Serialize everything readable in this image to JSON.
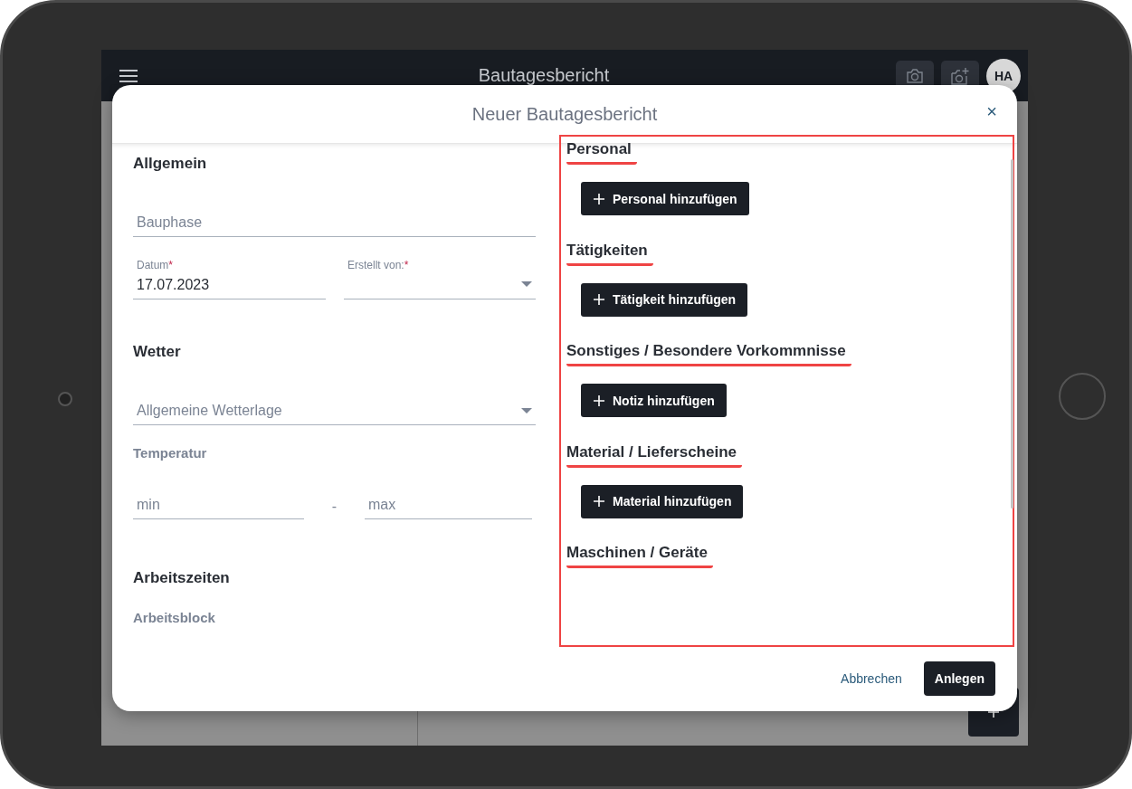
{
  "app_bar": {
    "title": "Bautagesbericht",
    "avatar": "HA"
  },
  "dialog": {
    "title": "Neuer Bautagesbericht",
    "close": "×",
    "general": {
      "heading": "Allgemein",
      "phase_field": {
        "placeholder": "Bauphase"
      },
      "date_field": {
        "label": "Datum",
        "required_mark": "*",
        "value": "17.07.2023"
      },
      "author_field": {
        "label": "Erstellt von:",
        "required_mark": "*"
      }
    },
    "weather": {
      "heading": "Wetter",
      "condition_field": {
        "placeholder": "Allgemeine Wetterlage"
      },
      "temperature_label": "Temperatur",
      "min_field": {
        "placeholder": "min"
      },
      "separator": "-",
      "max_field": {
        "placeholder": "max"
      }
    },
    "work_times": {
      "heading": "Arbeitszeiten",
      "block_label": "Arbeitsblock"
    },
    "sections": [
      {
        "heading": "Personal",
        "button": "Personal hinzufügen"
      },
      {
        "heading": "Tätigkeiten",
        "button": "Tätigkeit hinzufügen"
      },
      {
        "heading": "Sonstiges / Besondere Vorkommnisse",
        "button": "Notiz hinzufügen"
      },
      {
        "heading": "Material / Lieferscheine",
        "button": "Material hinzufügen"
      },
      {
        "heading": "Maschinen / Geräte"
      }
    ],
    "cancel": "Abbrechen",
    "submit": "Anlegen"
  }
}
